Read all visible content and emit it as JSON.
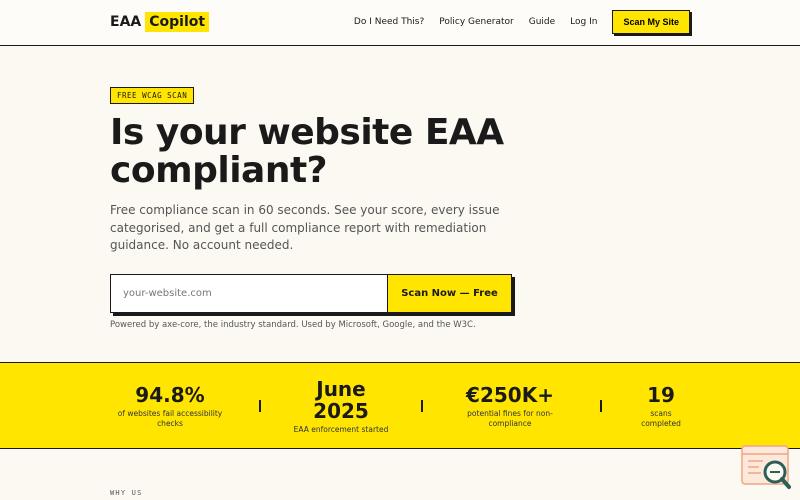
{
  "nav": {
    "brand_part1": "EAA",
    "brand_part2": "Copilot",
    "links": [
      "Do I Need This?",
      "Policy Generator",
      "Guide",
      "Log In"
    ],
    "cta": "Scan My Site"
  },
  "hero": {
    "badge": "FREE WCAG SCAN",
    "title": "Is your website EAA compliant?",
    "subtitle": "Free compliance scan in 60 seconds. See your score, every issue categorised, and get a full compliance report with remediation guidance. No account needed.",
    "input_placeholder": "your-website.com",
    "button": "Scan Now — Free",
    "powered_by": "Powered by axe-core, the industry standard. Used by Microsoft, Google, and the W3C."
  },
  "stats": [
    {
      "value": "94.8%",
      "label": "of websites fail accessibility checks"
    },
    {
      "value": "June 2025",
      "label": "EAA enforcement started"
    },
    {
      "value": "€250K+",
      "label": "potential fines for non-compliance"
    },
    {
      "value": "19",
      "label": "scans completed"
    }
  ],
  "section_label": "WHY US",
  "colors": {
    "accent": "#ffe500",
    "ink": "#1a1a1a",
    "background": "#fbf9f2"
  },
  "widget_icon": "search-magnifier-icon"
}
